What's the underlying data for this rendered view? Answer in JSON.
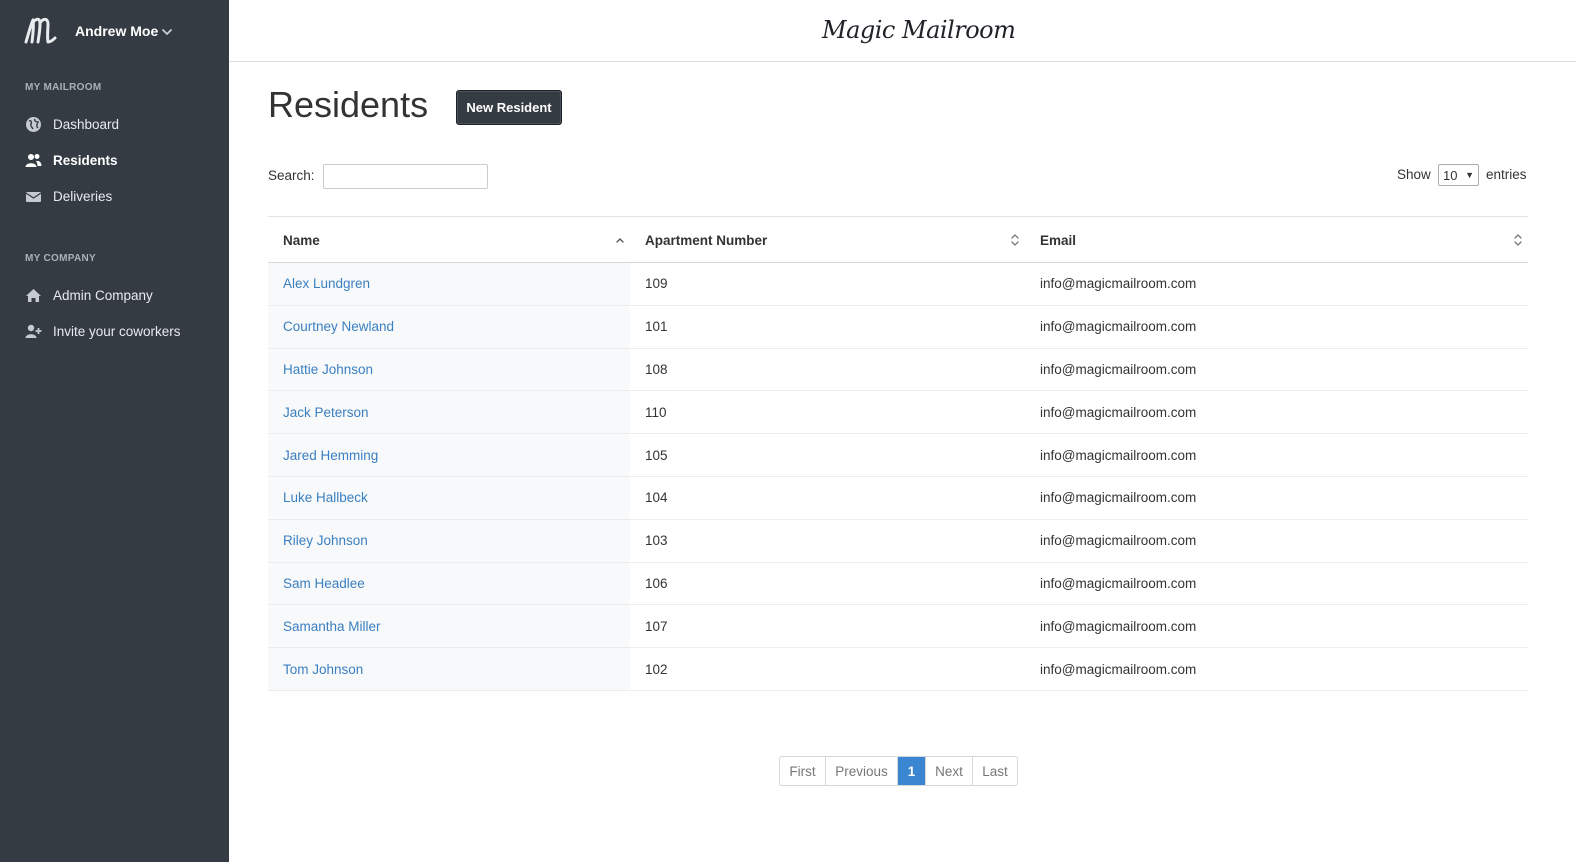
{
  "app": {
    "brand": "Magic Mailroom"
  },
  "user": {
    "name": "Andrew Moe"
  },
  "sidebar": {
    "sections": [
      {
        "title": "MY MAILROOM"
      },
      {
        "title": "MY COMPANY"
      }
    ],
    "items": [
      {
        "label": "Dashboard",
        "icon": "globe-icon"
      },
      {
        "label": "Residents",
        "icon": "users-icon",
        "active": true
      },
      {
        "label": "Deliveries",
        "icon": "envelope-icon"
      },
      {
        "label": "Admin Company",
        "icon": "home-icon"
      },
      {
        "label": "Invite your coworkers",
        "icon": "user-plus-icon"
      }
    ]
  },
  "page": {
    "title": "Residents",
    "new_button": "New Resident",
    "search_label": "Search:",
    "search_value": "",
    "show_label": "Show",
    "show_value": "10",
    "entries_label": "entries"
  },
  "table": {
    "headers": [
      "Name",
      "Apartment Number",
      "Email"
    ],
    "rows": [
      {
        "name": "Alex Lundgren",
        "apt": "109",
        "email": "info@magicmailroom.com"
      },
      {
        "name": "Courtney Newland",
        "apt": "101",
        "email": "info@magicmailroom.com"
      },
      {
        "name": "Hattie Johnson",
        "apt": "108",
        "email": "info@magicmailroom.com"
      },
      {
        "name": "Jack Peterson",
        "apt": "110",
        "email": "info@magicmailroom.com"
      },
      {
        "name": "Jared Hemming",
        "apt": "105",
        "email": "info@magicmailroom.com"
      },
      {
        "name": "Luke Hallbeck",
        "apt": "104",
        "email": "info@magicmailroom.com"
      },
      {
        "name": "Riley Johnson",
        "apt": "103",
        "email": "info@magicmailroom.com"
      },
      {
        "name": "Sam Headlee",
        "apt": "106",
        "email": "info@magicmailroom.com"
      },
      {
        "name": "Samantha Miller",
        "apt": "107",
        "email": "info@magicmailroom.com"
      },
      {
        "name": "Tom Johnson",
        "apt": "102",
        "email": "info@magicmailroom.com"
      }
    ]
  },
  "pagination": {
    "first": "First",
    "previous": "Previous",
    "current": "1",
    "next": "Next",
    "last": "Last"
  },
  "colors": {
    "sidebar_bg": "#343b43",
    "link": "#3a7fc1",
    "active_page": "#3a86d0"
  }
}
